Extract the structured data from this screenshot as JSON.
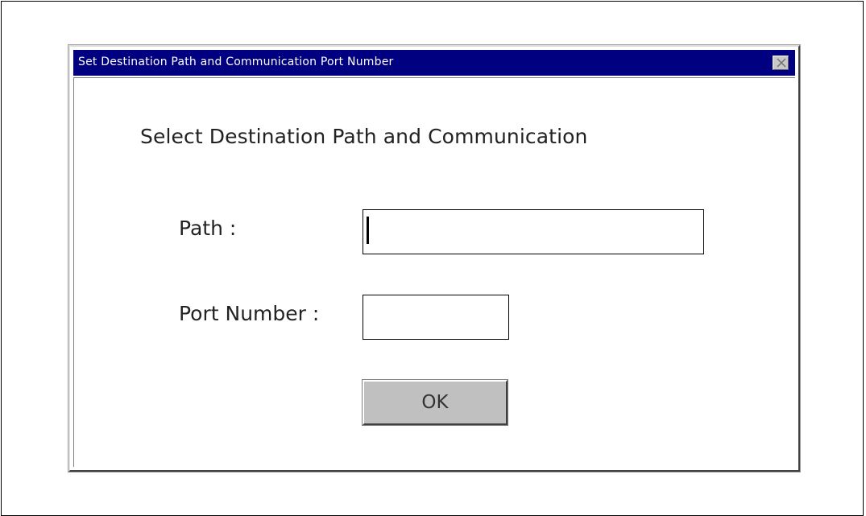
{
  "dialog": {
    "title": "Set Destination Path and Communication Port Number",
    "close_icon": "close-icon",
    "heading": "Select Destination Path and Communication",
    "path_label": "Path :",
    "path_value": "",
    "port_label": "Port Number :",
    "port_value": "",
    "ok_label": "OK"
  },
  "colors": {
    "titlebar": "#000080",
    "titlebar_text": "#ffffff",
    "button_face": "#c0c0c0"
  }
}
